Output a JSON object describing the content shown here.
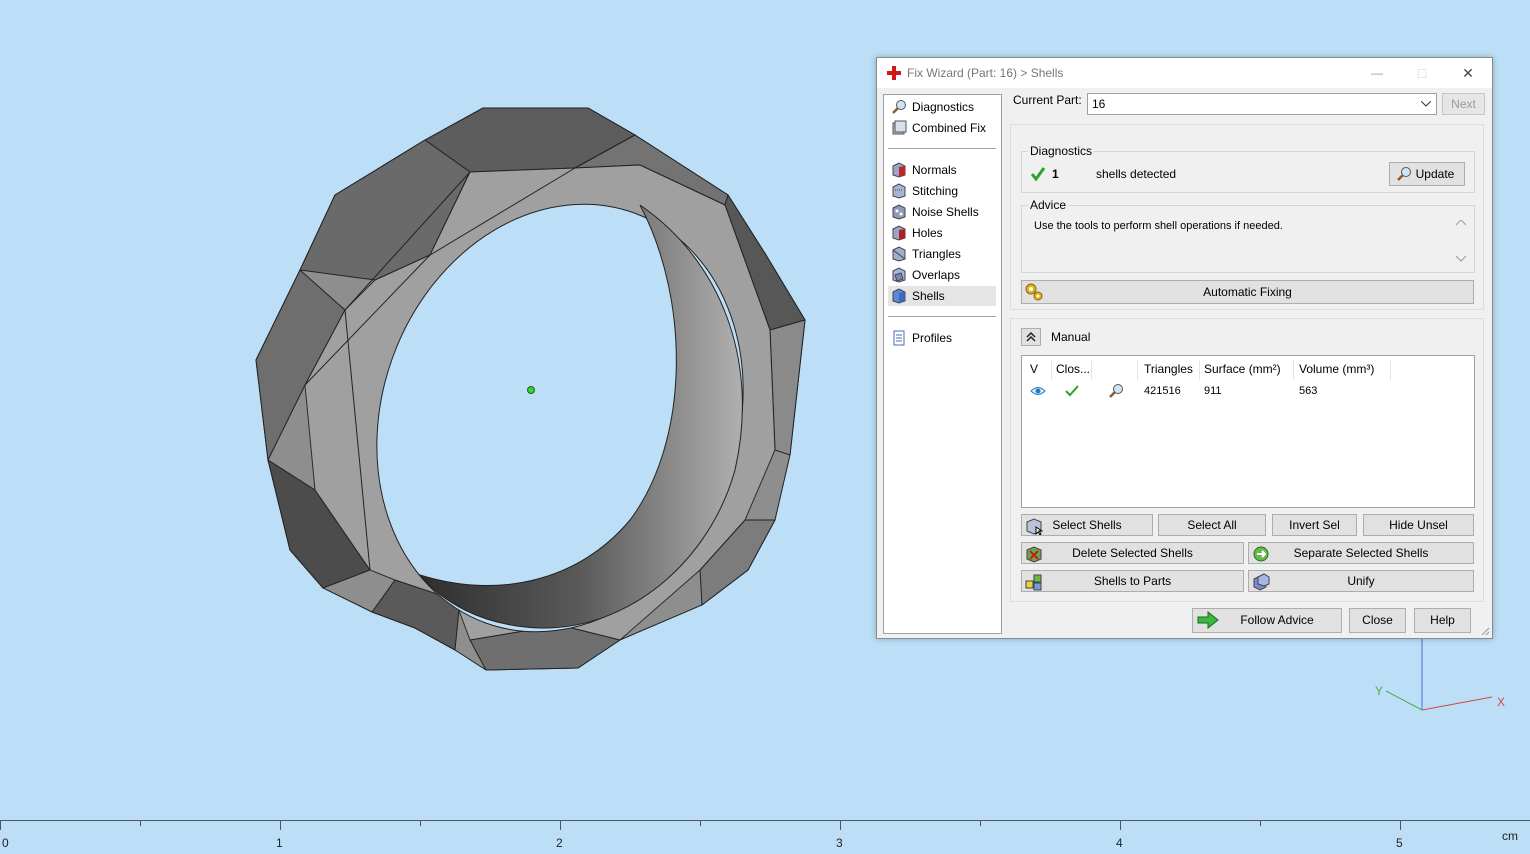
{
  "dialog": {
    "title": "Fix Wizard (Part: 16) > Shells",
    "minimize_glyph": "—",
    "maximize_glyph": "□",
    "close_glyph": "✕"
  },
  "sidebar": {
    "items": [
      {
        "label": "Diagnostics",
        "icon": "magnifier-icon"
      },
      {
        "label": "Combined Fix",
        "icon": "combined-fix-icon"
      },
      {
        "label": "Normals",
        "icon": "normals-icon"
      },
      {
        "label": "Stitching",
        "icon": "stitching-icon"
      },
      {
        "label": "Noise Shells",
        "icon": "noise-shells-icon"
      },
      {
        "label": "Holes",
        "icon": "holes-icon"
      },
      {
        "label": "Triangles",
        "icon": "triangles-icon"
      },
      {
        "label": "Overlaps",
        "icon": "overlaps-icon"
      },
      {
        "label": "Shells",
        "icon": "shells-icon"
      },
      {
        "label": "Profiles",
        "icon": "profiles-icon"
      }
    ],
    "active": "Shells"
  },
  "current_part": {
    "label": "Current Part:",
    "value": "16",
    "next_label": "Next"
  },
  "diagnostics": {
    "title": "Diagnostics",
    "count": "1",
    "status_text": "shells detected",
    "update_label": "Update"
  },
  "advice": {
    "title": "Advice",
    "text": "Use the tools to perform shell operations if needed."
  },
  "automatic_fixing_label": "Automatic Fixing",
  "manual": {
    "title": "Manual",
    "columns": [
      "V",
      "Clos...",
      "",
      "Triangles",
      "Surface (mm²)",
      "Volume (mm³)"
    ],
    "rows": [
      {
        "triangles": "421516",
        "surface": "911",
        "volume": "563"
      }
    ],
    "buttons": {
      "select_shells": "Select Shells",
      "select_all": "Select All",
      "invert_sel": "Invert Sel",
      "hide_unsel": "Hide Unsel",
      "delete_selected": "Delete Selected Shells",
      "separate_selected": "Separate Selected Shells",
      "shells_to_parts": "Shells to Parts",
      "unify": "Unify"
    }
  },
  "footer": {
    "follow_advice": "Follow Advice",
    "close": "Close",
    "help": "Help"
  },
  "ruler": {
    "labels": [
      "0",
      "1",
      "2",
      "3",
      "4",
      "5"
    ],
    "unit": "cm"
  },
  "axes": {
    "x": "X",
    "y": "Y"
  },
  "colors": {
    "background": "#bcdff7",
    "part_light": "#9c9c9c",
    "part_dark": "#4a4a4a",
    "check_green": "#2aa52a"
  }
}
